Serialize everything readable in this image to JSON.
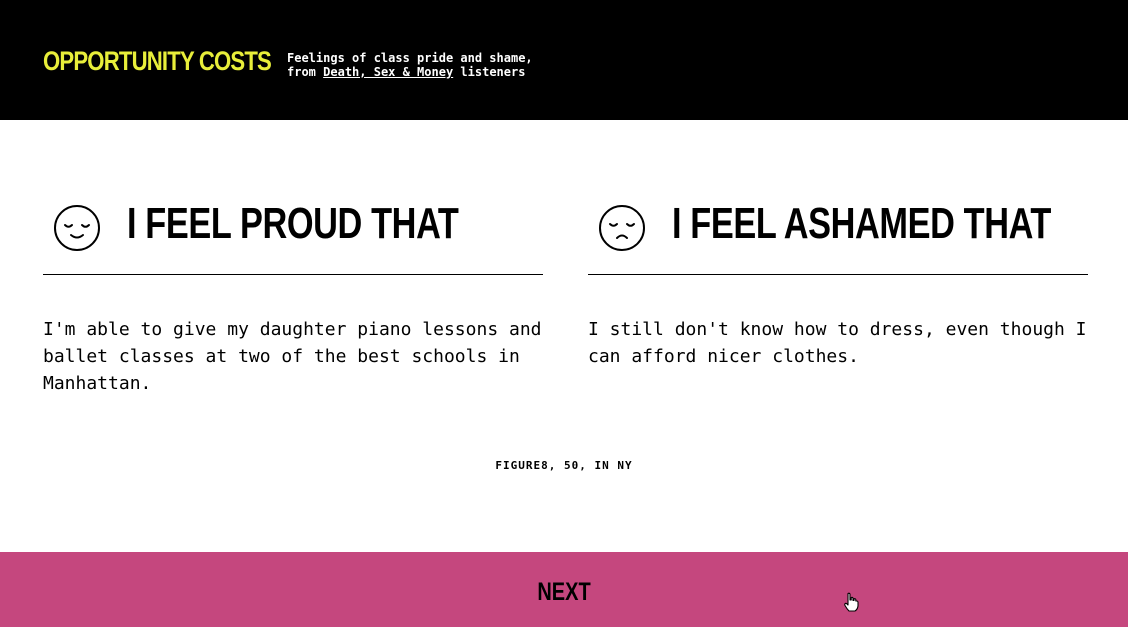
{
  "colors": {
    "header_bg": "#000000",
    "brand": "#e8ee3a",
    "accent_bar": "#c5477e",
    "text": "#000000"
  },
  "header": {
    "brand": "OPPORTUNITY COSTS",
    "tagline_line1": "Feelings of class pride and shame,",
    "tagline_from": "from",
    "tagline_link": "Death, Sex & Money",
    "tagline_suffix": "listeners"
  },
  "proud": {
    "icon": "content-face-icon",
    "title": "I FEEL PROUD THAT",
    "text": "I'm able to give my daughter piano lessons and ballet classes at two of the best schools in Manhattan."
  },
  "ashamed": {
    "icon": "sad-face-icon",
    "title": "I FEEL ASHAMED THAT",
    "text": "I still don't know how to dress, even though I can afford nicer clothes."
  },
  "attribution": "FIGURE8, 50, IN NY",
  "next": {
    "label": "NEXT"
  }
}
